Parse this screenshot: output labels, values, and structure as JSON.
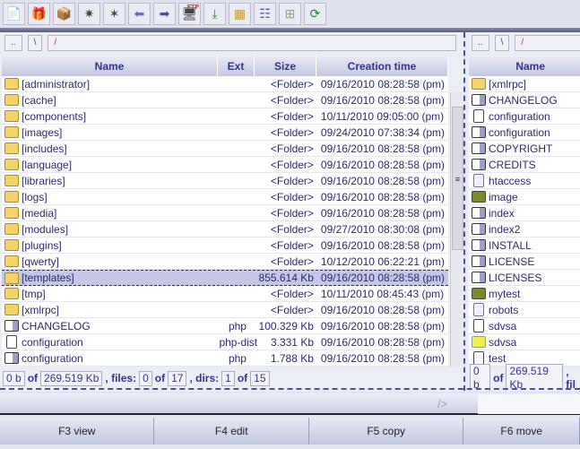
{
  "toolbar": {
    "icons": [
      "notepad-icon",
      "pack-icon",
      "unpack-icon",
      "star-icon",
      "invert-selection-icon",
      "back-icon",
      "forward-icon",
      "ftp-icon",
      "download-icon",
      "brief-view-icon",
      "full-view-icon",
      "tree-view-icon",
      "refresh-icon"
    ],
    "ftp_label": "FTP"
  },
  "left": {
    "path": {
      "up": "..",
      "root": "\\",
      "current": "/"
    },
    "columns": [
      "Name",
      "Ext",
      "Size",
      "Creation time"
    ],
    "rows": [
      {
        "name": "[administrator]",
        "ext": "",
        "size": "<Folder>",
        "time": "09/16/2010 08:28:58 (pm)",
        "type": "folder"
      },
      {
        "name": "[cache]",
        "ext": "",
        "size": "<Folder>",
        "time": "09/16/2010 08:28:58 (pm)",
        "type": "folder"
      },
      {
        "name": "[components]",
        "ext": "",
        "size": "<Folder>",
        "time": "10/11/2010 09:05:00 (pm)",
        "type": "folder"
      },
      {
        "name": "[images]",
        "ext": "",
        "size": "<Folder>",
        "time": "09/24/2010 07:38:34 (pm)",
        "type": "folder"
      },
      {
        "name": "[includes]",
        "ext": "",
        "size": "<Folder>",
        "time": "09/16/2010 08:28:58 (pm)",
        "type": "folder"
      },
      {
        "name": "[language]",
        "ext": "",
        "size": "<Folder>",
        "time": "09/16/2010 08:28:58 (pm)",
        "type": "folder"
      },
      {
        "name": "[libraries]",
        "ext": "",
        "size": "<Folder>",
        "time": "09/16/2010 08:28:58 (pm)",
        "type": "folder"
      },
      {
        "name": "[logs]",
        "ext": "",
        "size": "<Folder>",
        "time": "09/16/2010 08:28:58 (pm)",
        "type": "folder"
      },
      {
        "name": "[media]",
        "ext": "",
        "size": "<Folder>",
        "time": "09/16/2010 08:28:58 (pm)",
        "type": "folder"
      },
      {
        "name": "[modules]",
        "ext": "",
        "size": "<Folder>",
        "time": "09/27/2010 08:30:08 (pm)",
        "type": "folder"
      },
      {
        "name": "[plugins]",
        "ext": "",
        "size": "<Folder>",
        "time": "09/16/2010 08:28:58 (pm)",
        "type": "folder"
      },
      {
        "name": "[qwerty]",
        "ext": "",
        "size": "<Folder>",
        "time": "10/12/2010 06:22:21 (pm)",
        "type": "folder"
      },
      {
        "name": "[templates]",
        "ext": "",
        "size": "855.614 Kb",
        "time": "09/16/2010 08:28:58 (pm)",
        "type": "folder",
        "selected": true
      },
      {
        "name": "[tmp]",
        "ext": "",
        "size": "<Folder>",
        "time": "10/11/2010 08:45:43 (pm)",
        "type": "folder"
      },
      {
        "name": "[xmlrpc]",
        "ext": "",
        "size": "<Folder>",
        "time": "09/16/2010 08:28:58 (pm)",
        "type": "folder"
      },
      {
        "name": "CHANGELOG",
        "ext": "php",
        "size": "100.329 Kb",
        "time": "09/16/2010 08:28:58 (pm)",
        "type": "php"
      },
      {
        "name": "configuration",
        "ext": "php-dist",
        "size": "3.331 Kb",
        "time": "09/16/2010 08:28:58 (pm)",
        "type": "file"
      },
      {
        "name": "configuration",
        "ext": "php",
        "size": "1.788 Kb",
        "time": "09/16/2010 08:28:58 (pm)",
        "type": "php"
      }
    ],
    "status": {
      "sel_size": "0 b",
      "of": "of",
      "total_size": "269.519 Kb",
      "files_label": ", files:",
      "files_sel": "0",
      "files_total": "17",
      "dirs_label": ", dirs:",
      "dirs_sel": "1",
      "dirs_total": "15"
    }
  },
  "right": {
    "path": {
      "up": "..",
      "root": "\\",
      "current": "/"
    },
    "columns": [
      "Name"
    ],
    "rows": [
      {
        "name": "[xmlrpc]",
        "type": "folder"
      },
      {
        "name": "CHANGELOG",
        "type": "php"
      },
      {
        "name": "configuration",
        "type": "file"
      },
      {
        "name": "configuration",
        "type": "php"
      },
      {
        "name": "COPYRIGHT",
        "type": "php"
      },
      {
        "name": "CREDITS",
        "type": "php"
      },
      {
        "name": "htaccess",
        "type": "txt"
      },
      {
        "name": "image",
        "type": "jpg"
      },
      {
        "name": "index",
        "type": "php"
      },
      {
        "name": "index2",
        "type": "php"
      },
      {
        "name": "INSTALL",
        "type": "php"
      },
      {
        "name": "LICENSE",
        "type": "php"
      },
      {
        "name": "LICENSES",
        "type": "php"
      },
      {
        "name": "mytest",
        "type": "jpg"
      },
      {
        "name": "robots",
        "type": "txt"
      },
      {
        "name": "sdvsa",
        "type": "file"
      },
      {
        "name": "sdvsa",
        "type": "cube"
      },
      {
        "name": "test",
        "type": "file"
      }
    ],
    "status": {
      "sel_size": "0 b",
      "of": "of",
      "total_size": "269.519 Kb",
      "files_label": ", fil"
    }
  },
  "command": {
    "prompt": "/>",
    "value": ""
  },
  "fkeys": [
    "F3 view",
    "F4 edit",
    "F5 copy",
    "F6 move"
  ]
}
